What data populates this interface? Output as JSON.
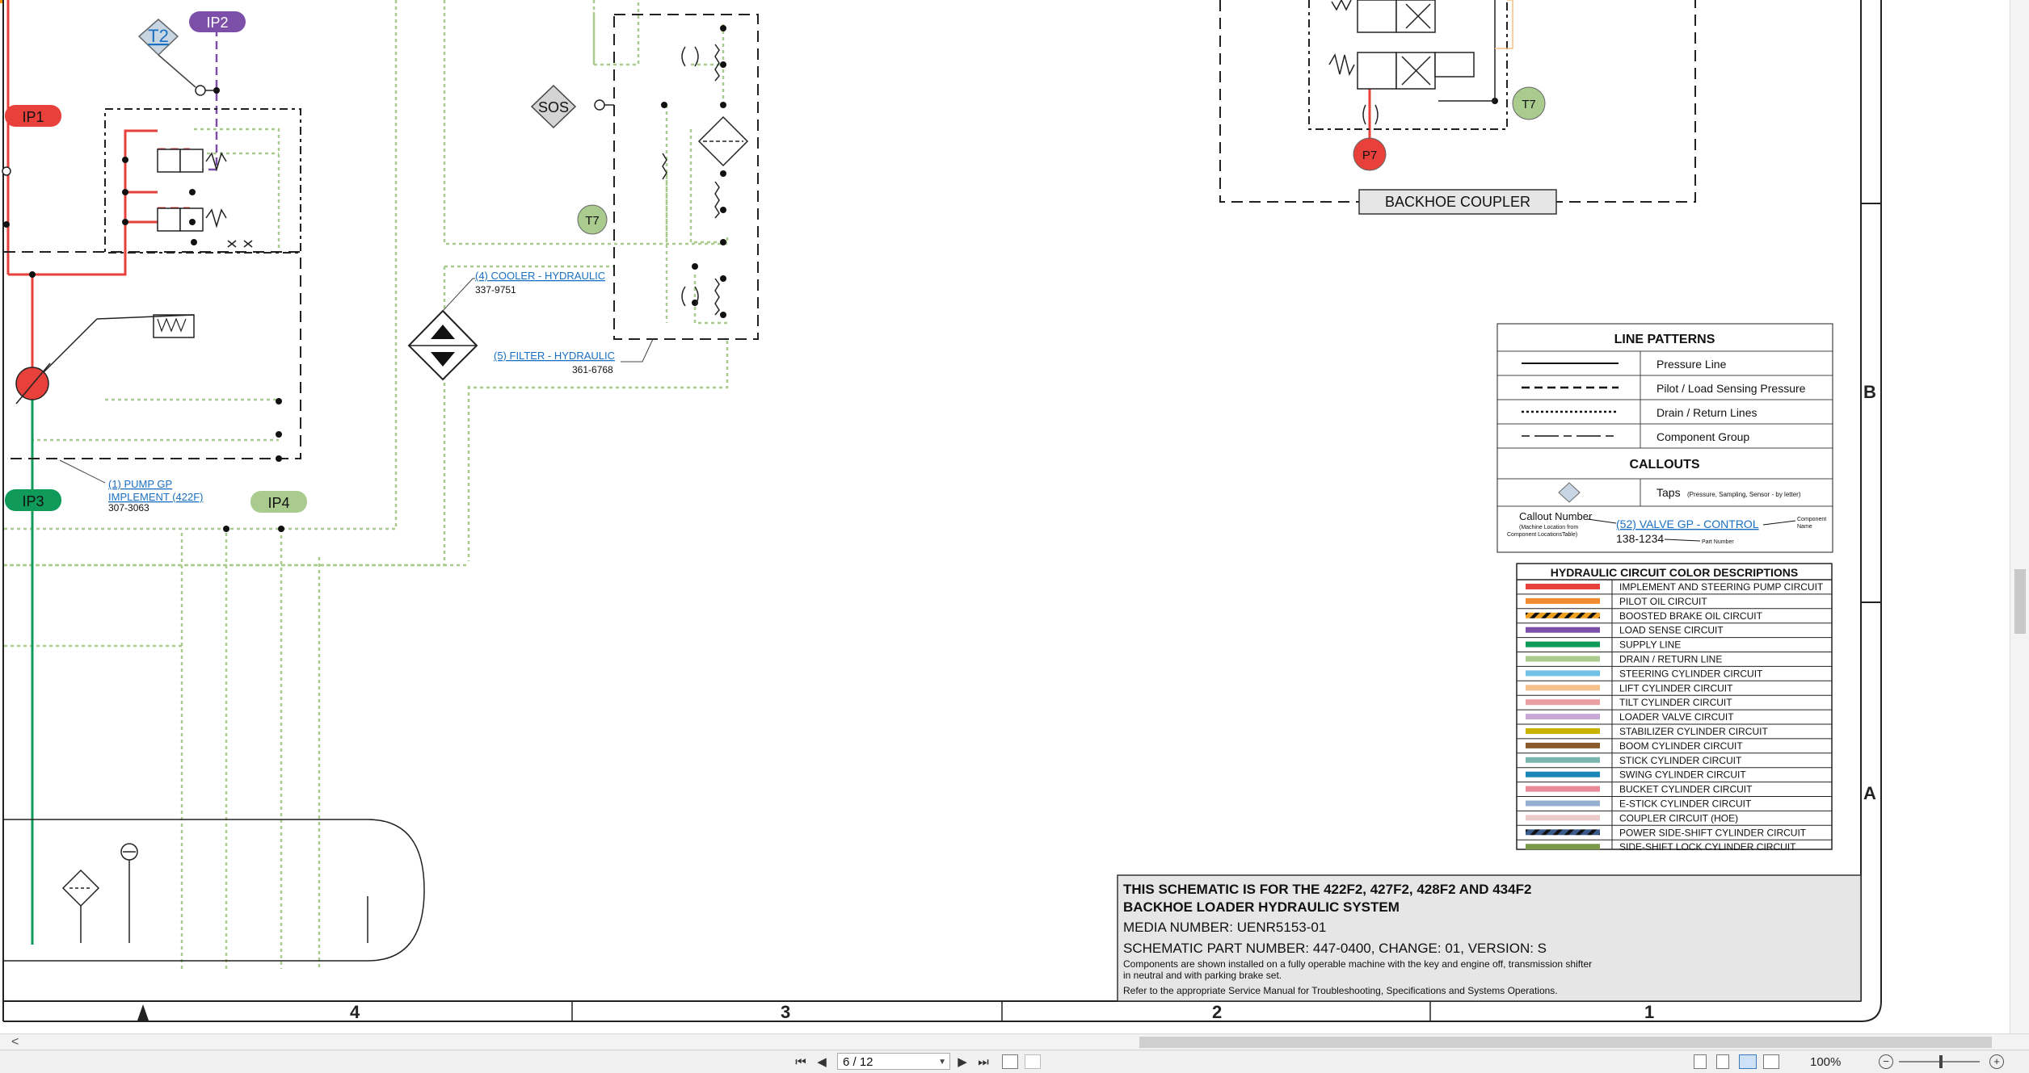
{
  "schematic": {
    "taps": {
      "t2": "T2",
      "ip2": "IP2",
      "ip1": "IP1",
      "ip3": "IP3",
      "ip4": "IP4",
      "sos": "SOS",
      "t7_left": "T7",
      "t7_right": "T7",
      "p7": "P7"
    },
    "coupler_label": "BACKHOE COUPLER",
    "pump_callout": {
      "link1": "(1) PUMP GP",
      "link2": "IMPLEMENT (422F)",
      "part": "307-3063"
    },
    "cooler_callout": {
      "link": "(4) COOLER - HYDRAULIC",
      "part": "337-9751"
    },
    "filter_callout": {
      "link": "(5) FILTER - HYDRAULIC",
      "part": "361-6768"
    },
    "zone_letters": [
      "B",
      "A"
    ],
    "zone_numbers": [
      "4",
      "3",
      "2",
      "1"
    ]
  },
  "line_patterns": {
    "title": "LINE PATTERNS",
    "rows": [
      "Pressure Line",
      "Pilot / Load Sensing Pressure",
      "Drain / Return Lines",
      "Component Group"
    ],
    "callouts_title": "CALLOUTS",
    "taps_label": "Taps",
    "taps_note": "(Pressure, Sampling, Sensor - by letter)",
    "callout_number": "Callout Number",
    "callout_number_note1": "(Machine Location from",
    "callout_number_note2": "Component LocationsTable)",
    "example_link": "(52) VALVE GP - CONTROL",
    "example_part": "138-1234",
    "component_name_1": "Component",
    "component_name_2": "Name",
    "part_number_note": "Part Number"
  },
  "color_descriptions": {
    "title": "HYDRAULIC CIRCUIT COLOR DESCRIPTIONS",
    "rows": [
      {
        "label": "IMPLEMENT AND STEERING PUMP CIRCUIT",
        "color": "#e8403a",
        "pattern": "solid"
      },
      {
        "label": "PILOT OIL CIRCUIT",
        "color": "#f28a2e",
        "pattern": "solid"
      },
      {
        "label": "BOOSTED BRAKE OIL CIRCUIT",
        "color": "#f0a020",
        "pattern": "hatch"
      },
      {
        "label": "LOAD SENSE CIRCUIT",
        "color": "#7c4fa8",
        "pattern": "solid"
      },
      {
        "label": "SUPPLY LINE",
        "color": "#0f9a5a",
        "pattern": "solid"
      },
      {
        "label": "DRAIN / RETURN LINE",
        "color": "#a9cc8e",
        "pattern": "solid"
      },
      {
        "label": "STEERING CYLINDER CIRCUIT",
        "color": "#72c2e8",
        "pattern": "solid"
      },
      {
        "label": "LIFT CYLINDER CIRCUIT",
        "color": "#f5c08a",
        "pattern": "solid"
      },
      {
        "label": "TILT CYLINDER CIRCUIT",
        "color": "#eaa0a0",
        "pattern": "solid"
      },
      {
        "label": "LOADER VALVE CIRCUIT",
        "color": "#c8a8d6",
        "pattern": "solid"
      },
      {
        "label": "STABILIZER CYLINDER CIRCUIT",
        "color": "#c8b400",
        "pattern": "solid"
      },
      {
        "label": "BOOM CYLINDER CIRCUIT",
        "color": "#8a5a2a",
        "pattern": "solid"
      },
      {
        "label": "STICK CYLINDER CIRCUIT",
        "color": "#7ab6b0",
        "pattern": "solid"
      },
      {
        "label": "SWING CYLINDER CIRCUIT",
        "color": "#1a86b8",
        "pattern": "solid"
      },
      {
        "label": "BUCKET CYLINDER CIRCUIT",
        "color": "#e88a98",
        "pattern": "solid"
      },
      {
        "label": "E-STICK CYLINDER CIRCUIT",
        "color": "#94aed0",
        "pattern": "solid"
      },
      {
        "label": "COUPLER CIRCUIT (HOE)",
        "color": "#eccaca",
        "pattern": "solid"
      },
      {
        "label": "POWER SIDE-SHIFT CYLINDER CIRCUIT",
        "color": "#3a5a8a",
        "pattern": "hatch"
      },
      {
        "label": "SIDE-SHIFT LOCK CYLINDER CIRCUIT",
        "color": "#7a9a4a",
        "pattern": "solid"
      }
    ]
  },
  "title_block": {
    "line1": "THIS SCHEMATIC IS FOR THE 422F2, 427F2, 428F2 AND 434F2",
    "line2": "BACKHOE LOADER HYDRAULIC SYSTEM",
    "media": "MEDIA NUMBER: UENR5153-01",
    "part": "SCHEMATIC PART NUMBER: 447-0400, CHANGE: 01, VERSION: S",
    "note1": "Components are shown installed on a fully operable machine with the key and engine off, transmission shifter",
    "note2": "in neutral and with parking brake set.",
    "note3": "Refer to the appropriate Service Manual for Troubleshooting, Specifications and Systems Operations."
  },
  "viewer": {
    "page_value": "6 / 12",
    "zoom": "100%",
    "buttons": {
      "first": "⏮",
      "prev": "◀",
      "next": "▶",
      "last": "⏭",
      "zoom_out": "−",
      "zoom_in": "+",
      "scroll_left": "<"
    }
  },
  "colors": {
    "pressure": "#e8403a",
    "drain": "#a9cc8e",
    "load_sense": "#7c4fa8",
    "supply": "#0f9a5a",
    "link": "#1a6fc2",
    "title_bg": "#e6e6e6"
  }
}
